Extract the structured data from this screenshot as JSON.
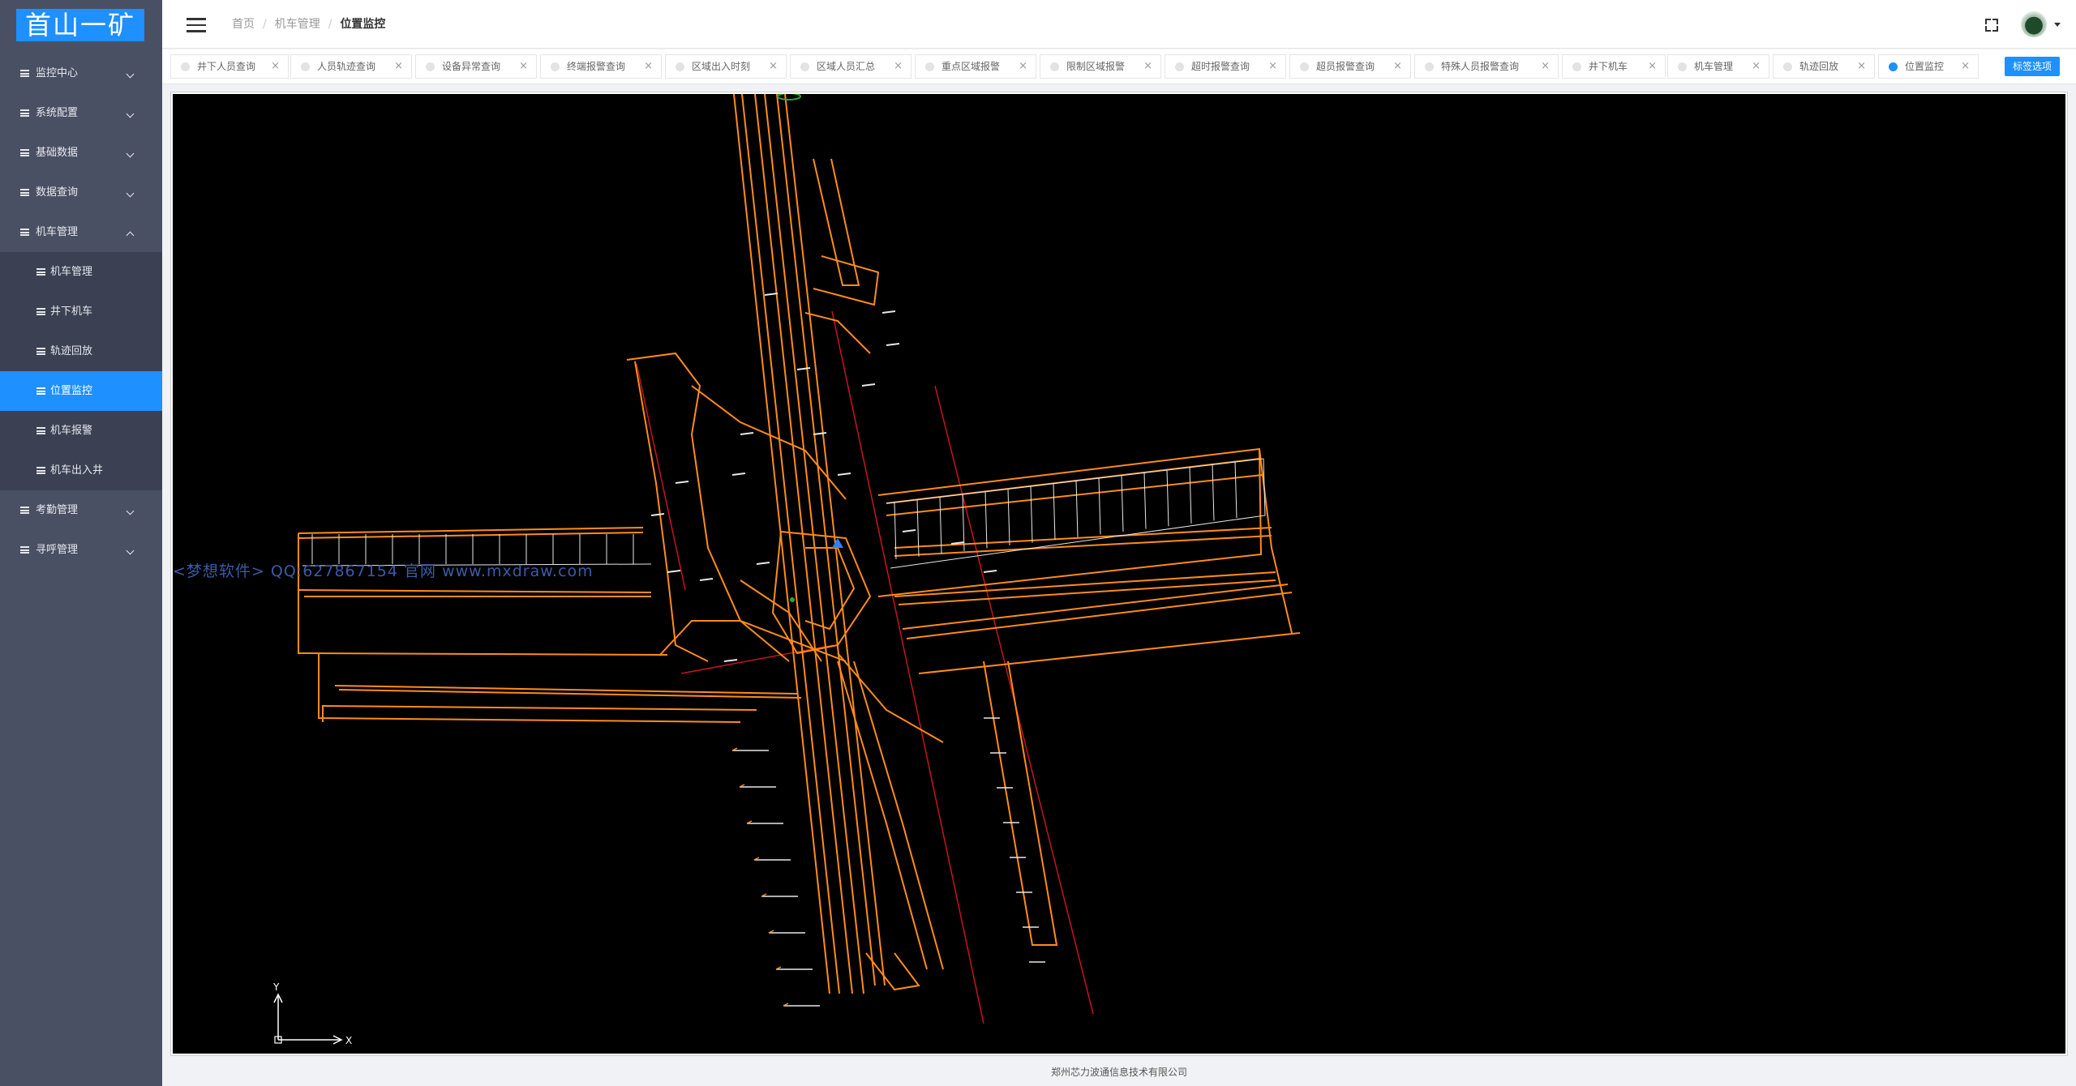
{
  "app": {
    "logo_text": "首山一矿",
    "brand_color": "#1e90ff",
    "sidebar_color": "#4a5064"
  },
  "sidebar": {
    "items": [
      {
        "label": "监控中心",
        "expanded": false
      },
      {
        "label": "系统配置",
        "expanded": false
      },
      {
        "label": "基础数据",
        "expanded": false
      },
      {
        "label": "数据查询",
        "expanded": false
      },
      {
        "label": "机车管理",
        "expanded": true,
        "children": [
          {
            "label": "机车管理"
          },
          {
            "label": "井下机车"
          },
          {
            "label": "轨迹回放"
          },
          {
            "label": "位置监控",
            "active": true
          },
          {
            "label": "机车报警"
          },
          {
            "label": "机车出入井"
          }
        ]
      },
      {
        "label": "考勤管理",
        "expanded": false
      },
      {
        "label": "寻呼管理",
        "expanded": false
      }
    ]
  },
  "header": {
    "breadcrumb": [
      "首页",
      "机车管理",
      "位置监控"
    ],
    "menu_icon": "hamburger-icon",
    "fullscreen_icon": "fullscreen-icon",
    "avatar_icon": "user-avatar"
  },
  "tabs": {
    "items": [
      {
        "label": "井下人员查询",
        "close": "×"
      },
      {
        "label": "人员轨迹查询",
        "close": "×"
      },
      {
        "label": "设备异常查询",
        "close": "×"
      },
      {
        "label": "终端报警查询",
        "close": "×"
      },
      {
        "label": "区域出入时刻",
        "close": "×"
      },
      {
        "label": "区域人员汇总",
        "close": "×"
      },
      {
        "label": "重点区域报警",
        "close": "×"
      },
      {
        "label": "限制区域报警",
        "close": "×"
      },
      {
        "label": "超时报警查询",
        "close": "×"
      },
      {
        "label": "超员报警查询",
        "close": "×"
      },
      {
        "label": "特殊人员报警查询",
        "close": "×"
      },
      {
        "label": "井下机车",
        "close": "×"
      },
      {
        "label": "机车管理",
        "close": "×"
      },
      {
        "label": "轨迹回放",
        "close": "×"
      },
      {
        "label": "位置监控",
        "close": "×",
        "active": true
      }
    ],
    "options_label": "标签选项"
  },
  "map": {
    "watermark": "<梦想软件> QQ:627867154 官网 www.mxdraw.com",
    "axis_x": "X",
    "axis_y": "Y",
    "background": "#000000",
    "line_color": "#ff8c1a"
  },
  "footer": {
    "text": "郑州芯力波通信息技术有限公司"
  }
}
